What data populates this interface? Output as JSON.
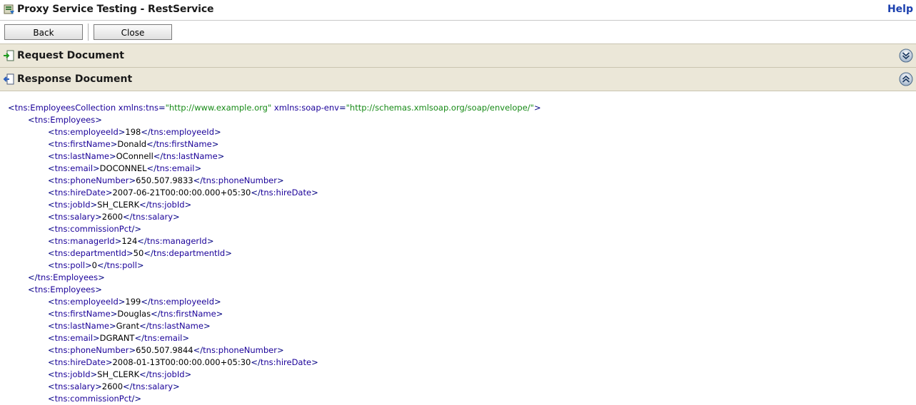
{
  "window": {
    "title": "Proxy Service Testing - RestService",
    "help_label": "Help"
  },
  "toolbar": {
    "back_label": "Back",
    "close_label": "Close"
  },
  "sections": {
    "request": {
      "title": "Request Document",
      "state": "collapsed"
    },
    "response": {
      "title": "Response Document",
      "state": "expanded"
    }
  },
  "xml": {
    "root": {
      "tag": "tns:EmployeesCollection",
      "attrs": [
        {
          "name": "xmlns:tns",
          "value": "\"http://www.example.org\""
        },
        {
          "name": "xmlns:soap-env",
          "value": "\"http://schemas.xmlsoap.org/soap/envelope/\""
        }
      ]
    },
    "employees_tag": "tns:Employees",
    "employees": [
      {
        "fields": [
          {
            "tag": "tns:employeeId",
            "value": "198"
          },
          {
            "tag": "tns:firstName",
            "value": "Donald"
          },
          {
            "tag": "tns:lastName",
            "value": "OConnell"
          },
          {
            "tag": "tns:email",
            "value": "DOCONNEL"
          },
          {
            "tag": "tns:phoneNumber",
            "value": "650.507.9833"
          },
          {
            "tag": "tns:hireDate",
            "value": "2007-06-21T00:00:00.000+05:30"
          },
          {
            "tag": "tns:jobId",
            "value": "SH_CLERK"
          },
          {
            "tag": "tns:salary",
            "value": "2600"
          },
          {
            "tag": "tns:commissionPct",
            "value": null
          },
          {
            "tag": "tns:managerId",
            "value": "124"
          },
          {
            "tag": "tns:departmentId",
            "value": "50"
          },
          {
            "tag": "tns:poll",
            "value": "0"
          }
        ],
        "closed": true
      },
      {
        "fields": [
          {
            "tag": "tns:employeeId",
            "value": "199"
          },
          {
            "tag": "tns:firstName",
            "value": "Douglas"
          },
          {
            "tag": "tns:lastName",
            "value": "Grant"
          },
          {
            "tag": "tns:email",
            "value": "DGRANT"
          },
          {
            "tag": "tns:phoneNumber",
            "value": "650.507.9844"
          },
          {
            "tag": "tns:hireDate",
            "value": "2008-01-13T00:00:00.000+05:30"
          },
          {
            "tag": "tns:jobId",
            "value": "SH_CLERK"
          },
          {
            "tag": "tns:salary",
            "value": "2600"
          },
          {
            "tag": "tns:commissionPct",
            "value": null
          }
        ],
        "closed": false
      }
    ]
  },
  "icons": {
    "title": "proxy-service-icon",
    "request": "request-arrow-icon",
    "response": "response-arrow-icon",
    "expand": "expand-double-chevron-down-icon",
    "collapse": "collapse-double-chevron-up-icon"
  },
  "colors": {
    "section_bg": "#ebe7d8",
    "help_link": "#1a3fae",
    "xml_tag": "#1a0099",
    "xml_attr_value": "#178a17"
  }
}
